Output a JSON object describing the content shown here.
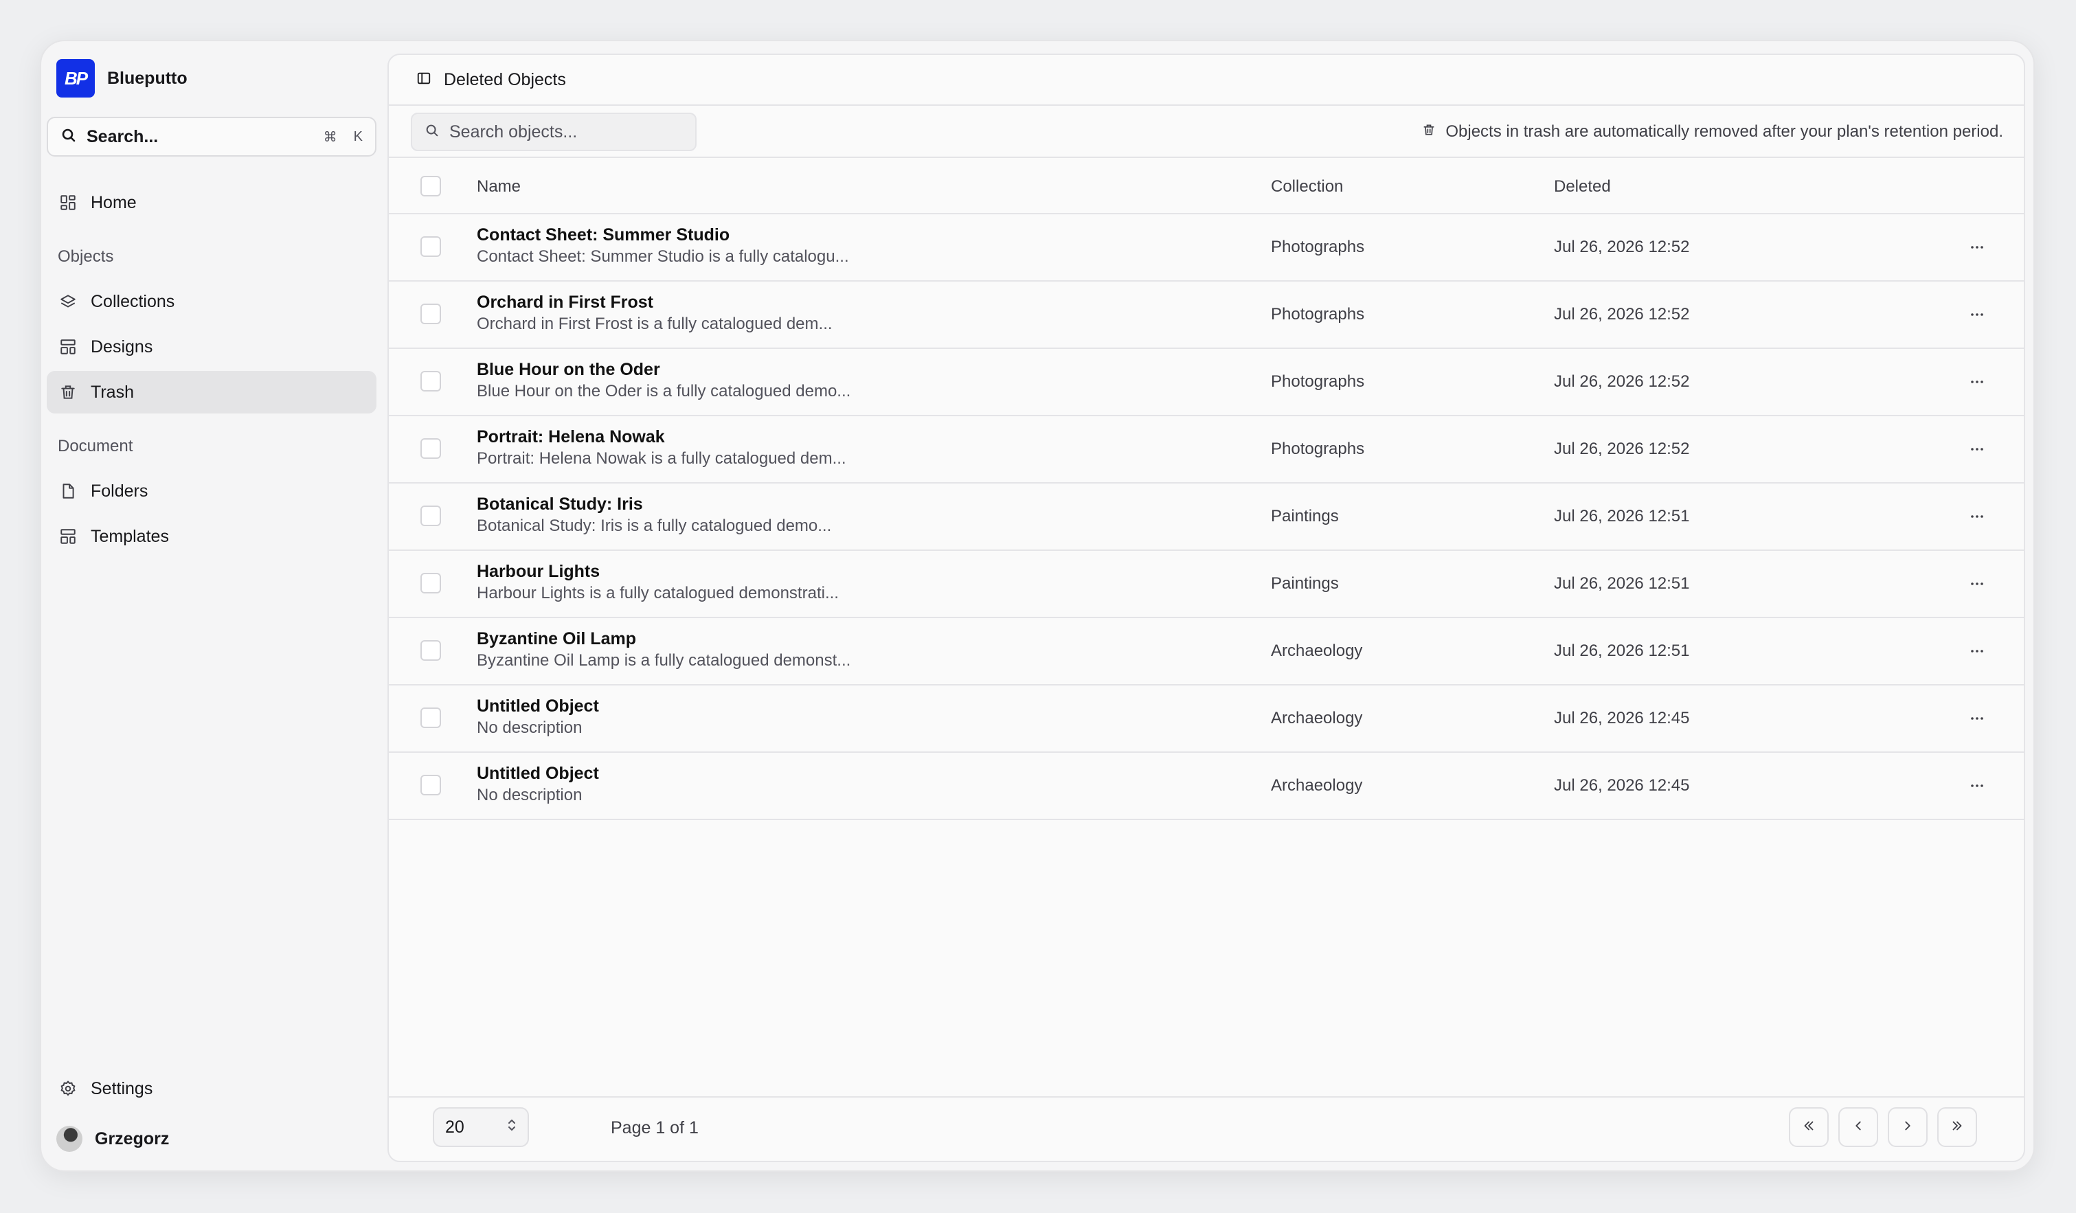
{
  "workspace": {
    "name": "Blueputto",
    "logo_text": "BP"
  },
  "sidebar": {
    "search": {
      "label": "Search...",
      "shortcut_mod": "⌘",
      "shortcut_key": "K"
    },
    "home_label": "Home",
    "objects_section": "Objects",
    "objects_items": [
      {
        "label": "Collections",
        "icon": "layers-icon"
      },
      {
        "label": "Designs",
        "icon": "layout-icon"
      },
      {
        "label": "Trash",
        "icon": "trash-icon",
        "active": true
      }
    ],
    "document_section": "Document",
    "document_items": [
      {
        "label": "Folders",
        "icon": "file-icon"
      },
      {
        "label": "Templates",
        "icon": "layout-icon"
      }
    ],
    "settings_label": "Settings",
    "user_name": "Grzegorz"
  },
  "main": {
    "title": "Deleted Objects",
    "search_placeholder": "Search objects...",
    "notice": "Objects in trash are automatically removed after your plan's retention period.",
    "columns": {
      "name": "Name",
      "collection": "Collection",
      "deleted": "Deleted"
    },
    "rows": [
      {
        "name": "Contact Sheet: Summer Studio",
        "desc": "Contact Sheet: Summer Studio is a fully catalogu...",
        "collection": "Photographs",
        "deleted": "Jul 26, 2026 12:52"
      },
      {
        "name": "Orchard in First Frost",
        "desc": "Orchard in First Frost is a fully catalogued dem...",
        "collection": "Photographs",
        "deleted": "Jul 26, 2026 12:52"
      },
      {
        "name": "Blue Hour on the Oder",
        "desc": "Blue Hour on the Oder is a fully catalogued demo...",
        "collection": "Photographs",
        "deleted": "Jul 26, 2026 12:52"
      },
      {
        "name": "Portrait: Helena Nowak",
        "desc": "Portrait: Helena Nowak is a fully catalogued dem...",
        "collection": "Photographs",
        "deleted": "Jul 26, 2026 12:52"
      },
      {
        "name": "Botanical Study: Iris",
        "desc": "Botanical Study: Iris is a fully catalogued demo...",
        "collection": "Paintings",
        "deleted": "Jul 26, 2026 12:51"
      },
      {
        "name": "Harbour Lights",
        "desc": "Harbour Lights is a fully catalogued demonstrati...",
        "collection": "Paintings",
        "deleted": "Jul 26, 2026 12:51"
      },
      {
        "name": "Byzantine Oil Lamp",
        "desc": "Byzantine Oil Lamp is a fully catalogued demonst...",
        "collection": "Archaeology",
        "deleted": "Jul 26, 2026 12:51"
      },
      {
        "name": "Untitled Object",
        "desc": "No description",
        "collection": "Archaeology",
        "deleted": "Jul 26, 2026 12:45"
      },
      {
        "name": "Untitled Object",
        "desc": "No description",
        "collection": "Archaeology",
        "deleted": "Jul 26, 2026 12:45"
      }
    ],
    "pagination": {
      "page_size": "20",
      "page_info": "Page 1 of 1"
    }
  },
  "colors": {
    "brand": "#1230e6",
    "active_nav": "#e4e4e6"
  }
}
